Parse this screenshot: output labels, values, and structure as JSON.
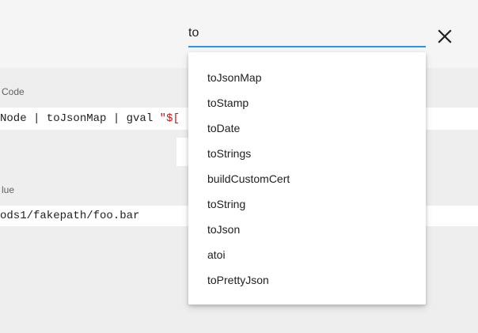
{
  "search": {
    "value": "to"
  },
  "form": {
    "code_label": "Code",
    "code_segments": {
      "plain": "Node | toJsonMap | gval ",
      "string": "\"$["
    },
    "value_label": "lue",
    "value_text": "ods1/fakepath/foo.bar"
  },
  "suggestions": [
    "toJsonMap",
    "toStamp",
    "toDate",
    "toStrings",
    "buildCustomCert",
    "toString",
    "toJson",
    "atoi",
    "toPrettyJson"
  ],
  "colors": {
    "accent": "#2196f3",
    "string": "#b71c1c"
  }
}
